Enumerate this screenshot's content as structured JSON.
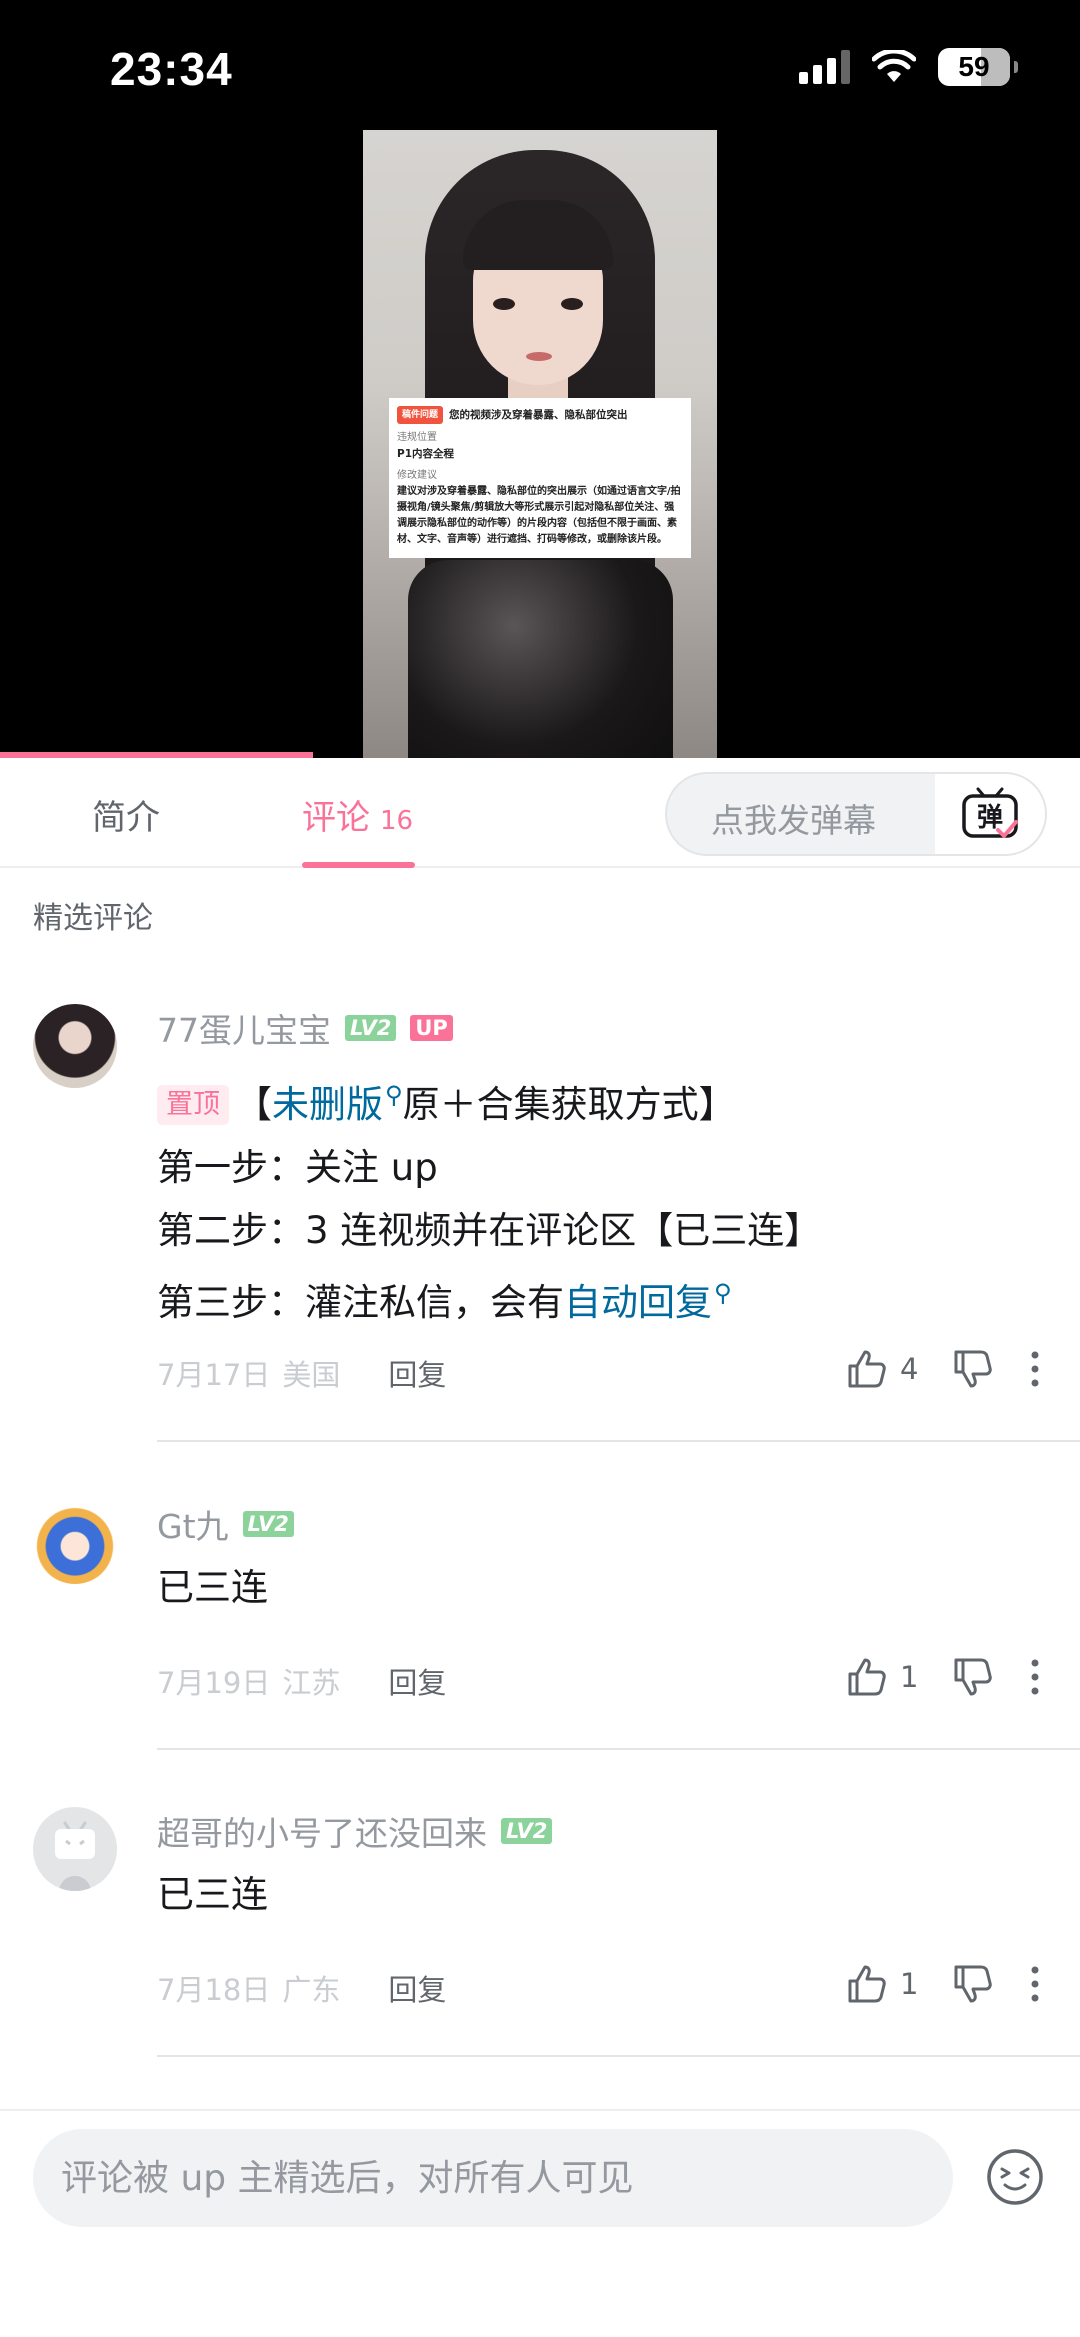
{
  "status_bar": {
    "time": "23:34",
    "battery": "59"
  },
  "video": {
    "playback_progress": 0.29,
    "notice": {
      "tag": "稿件问题",
      "headline": "您的视频涉及穿着暴露、隐私部位突出",
      "position_label": "违规位置",
      "position_value": "P1内容全程",
      "suggestion_label": "修改建议",
      "suggestion_body": "建议对涉及穿着暴露、隐私部位的突出展示（如通过语言文字/拍摄视角/镜头聚焦/剪辑放大等形式展示引起对隐私部位关注、强调展示隐私部位的动作等）的片段内容（包括但不限于画面、素材、文字、音声等）进行遮挡、打码等修改，或删除该片段。"
    }
  },
  "tabs": {
    "intro_label": "简介",
    "comments_label": "评论",
    "comments_count": "16",
    "danmaku_placeholder": "点我发弹幕",
    "danmaku_icon_label": "弹"
  },
  "section_title": "精选评论",
  "comments": [
    {
      "username": "77蛋儿宝宝",
      "level": "LV2",
      "up_badge": "UP",
      "pinned_label": "置顶",
      "line1_pre": "【",
      "line1_link": "未删版",
      "line1_post": "原＋合集获取方式】",
      "line2": "第一步：关注 up",
      "line3": "第二步：3 连视频并在评论区【已三连】",
      "line4_pre": "第三步：灌注私信，会有",
      "line4_link": "自动回复",
      "date": "7月17日",
      "location": "美国",
      "reply_label": "回复",
      "likes": "4"
    },
    {
      "username": "Gt九",
      "level": "LV2",
      "text": "已三连",
      "date": "7月19日",
      "location": "江苏",
      "reply_label": "回复",
      "likes": "1"
    },
    {
      "username": "超哥的小号了还没回来",
      "level": "LV2",
      "text": "已三连",
      "date": "7月18日",
      "location": "广东",
      "reply_label": "回复",
      "likes": "1"
    }
  ],
  "bottom": {
    "input_placeholder": "评论被 up 主精选后，对所有人可见"
  },
  "colors": {
    "accent": "#fb7299",
    "link": "#00699d",
    "level_badge": "#8bd29b"
  }
}
